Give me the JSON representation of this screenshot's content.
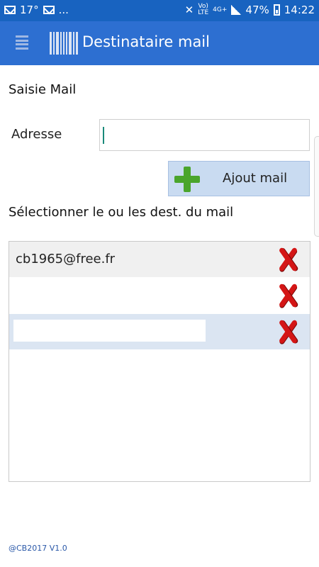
{
  "statusbar": {
    "temperature": "17°",
    "dots": "...",
    "volte_top": "Vo)",
    "volte_bottom": "LTE",
    "network": "4G+",
    "battery": "47%",
    "time": "14:22"
  },
  "appbar": {
    "title": "Destinataire mail"
  },
  "form": {
    "section_title": "Saisie Mail",
    "address_label": "Adresse",
    "address_value": "",
    "add_button_label": "Ajout mail"
  },
  "list": {
    "select_label": "Sélectionner le ou les dest. du mail",
    "rows": [
      {
        "text": "cb1965@free.fr",
        "bg": "#f0f0f0"
      },
      {
        "text": "",
        "bg": "#ffffff"
      },
      {
        "text": "",
        "bg": "#dbe5f2"
      }
    ]
  },
  "footer": {
    "version": "@CB2017 V1.0"
  },
  "colors": {
    "statusbar": "#1863c0",
    "appbar": "#2d6fd1",
    "button": "#c9dbf1",
    "delete": "#d41616",
    "add": "#4aa52c"
  },
  "icons": [
    "mail-icon",
    "menu-icon",
    "barcode-logo",
    "plus-icon",
    "delete-icon"
  ]
}
